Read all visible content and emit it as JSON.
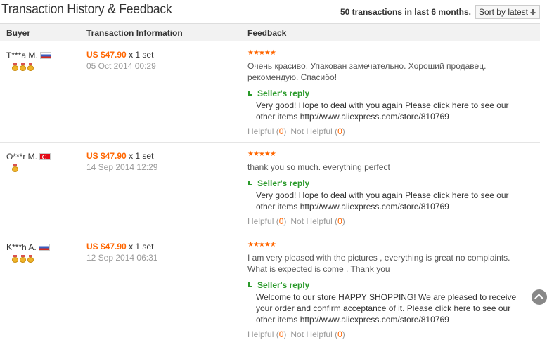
{
  "header": {
    "title": "Transaction History & Feedback",
    "summary": "50 transactions in last 6 months.",
    "sort_label": "Sort by latest"
  },
  "columns": {
    "buyer": "Buyer",
    "info": "Transaction Information",
    "feedback": "Feedback"
  },
  "rows": [
    {
      "buyer": "T***a M.",
      "flag": "russia-flag",
      "medals": 3,
      "price": "US $47.90",
      "qty": "x 1 set",
      "date": "05 Oct 2014 00:29",
      "stars": "★★★★★",
      "rating": 5,
      "text": "Очень красиво. Упакован замечательно. Хороший продавец. рекомендую. Спасибо!",
      "reply_label": "Seller's reply",
      "reply": "Very good! Hope to deal with you again Please click here to see our other items http://www.aliexpress.com/store/810769",
      "helpful_label": "Helpful",
      "helpful_count": "0",
      "not_helpful_label": "Not Helpful",
      "not_helpful_count": "0"
    },
    {
      "buyer": "O***r M.",
      "flag": "turkey-flag",
      "medals": 1,
      "price": "US $47.90",
      "qty": "x 1 set",
      "date": "14 Sep 2014 12:29",
      "stars": "★★★★★",
      "rating": 5,
      "text": "thank you so much. everything perfect",
      "reply_label": "Seller's reply",
      "reply": "Very good! Hope to deal with you again Please click here to see our other items http://www.aliexpress.com/store/810769",
      "helpful_label": "Helpful",
      "helpful_count": "0",
      "not_helpful_label": "Not Helpful",
      "not_helpful_count": "0"
    },
    {
      "buyer": "K***h A.",
      "flag": "russia-flag",
      "medals": 3,
      "price": "US $47.90",
      "qty": "x 1 set",
      "date": "12 Sep 2014 06:31",
      "stars": "★★★★★",
      "rating": 5,
      "text": "I am very pleased with the pictures , everything is great no complaints. What is expected is come . Thank you",
      "reply_label": "Seller's reply",
      "reply": "Welcome to our store HAPPY SHOPPING! We are pleased to receive your order and confirm acceptance of it. Please click here to see our other items http://www.aliexpress.com/store/810769",
      "helpful_label": "Helpful",
      "helpful_count": "0",
      "not_helpful_label": "Not Helpful",
      "not_helpful_count": "0"
    }
  ],
  "colors": {
    "price": "#ff6600",
    "reply": "#2a9a2a",
    "muted": "#999999"
  }
}
